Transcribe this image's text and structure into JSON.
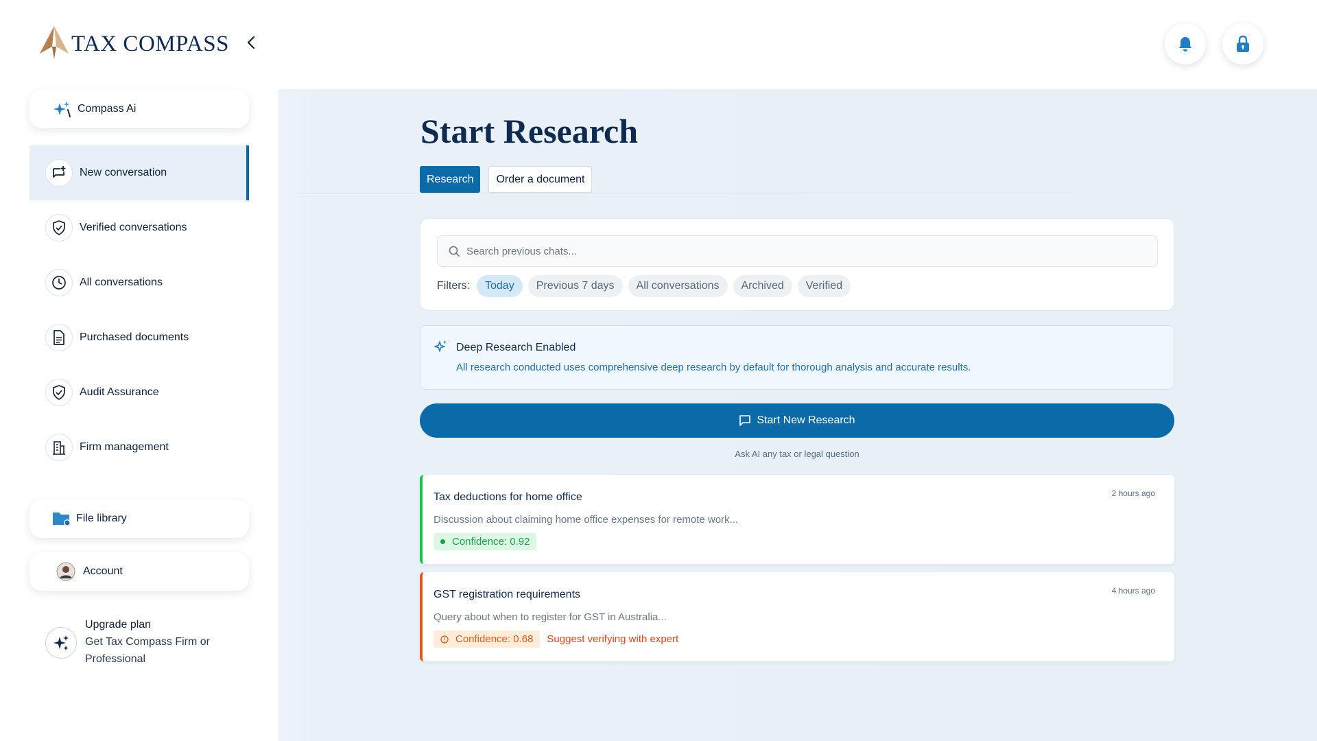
{
  "sidebar": {
    "logo_text": "TAX COMPASS",
    "compass_ai": "Compass Ai",
    "nav": [
      {
        "label": "New conversation",
        "icon": "chat-plus-icon"
      },
      {
        "label": "Verified conversations",
        "icon": "shield-check-icon"
      },
      {
        "label": "All conversations",
        "icon": "clock-icon"
      },
      {
        "label": "Purchased documents",
        "icon": "document-icon"
      },
      {
        "label": "Audit Assurance",
        "icon": "shield-check-icon"
      },
      {
        "label": "Firm management",
        "icon": "building-icon"
      }
    ],
    "file_library": "File library",
    "account": "Account",
    "upgrade": {
      "title": "Upgrade plan",
      "subtitle": "Get Tax Compass Firm or Professional"
    }
  },
  "main": {
    "title": "Start Research",
    "tabs": [
      {
        "label": "Research"
      },
      {
        "label": "Order a document"
      }
    ],
    "search": {
      "placeholder": "Search previous chats..."
    },
    "filters": {
      "label": "Filters:",
      "items": [
        "Today",
        "Previous 7 days",
        "All conversations",
        "Archived",
        "Verified"
      ]
    },
    "deep_research": {
      "title": "Deep Research Enabled",
      "description": "All research conducted uses comprehensive deep research by default for thorough analysis and accurate results."
    },
    "start_button": "Start New Research",
    "start_hint": "Ask AI any tax or legal question",
    "conversations": [
      {
        "title": "Tax deductions for home office",
        "time": "2 hours ago",
        "description": "Discussion about claiming home office expenses for remote work...",
        "confidence": "Confidence: 0.92"
      },
      {
        "title": "GST registration requirements",
        "time": "4 hours ago",
        "description": "Query about when to register for GST in Australia...",
        "confidence": "Confidence: 0.68",
        "suggestion": "Suggest verifying with expert"
      }
    ]
  },
  "colors": {
    "primary": "#0b6aa8",
    "navy": "#0f2a4f",
    "success": "#16a34a",
    "warning": "#e0561b",
    "logo_gold": "#c8916a"
  }
}
